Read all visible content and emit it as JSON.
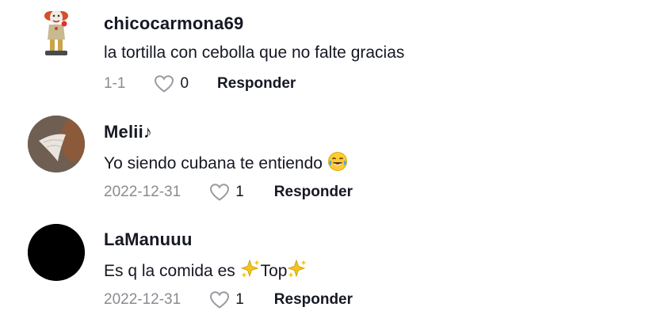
{
  "comments": [
    {
      "username": "chicocarmona69",
      "text": "la tortilla con cebolla que no falte gracias",
      "date": "1-1",
      "likes": "0",
      "reply_label": "Responder",
      "avatar_icon": "pennywise-figure-avatar",
      "emojis": []
    },
    {
      "username": "Melii♪",
      "text": "Yo siendo cubana te entiendo",
      "date": "2022-12-31",
      "likes": "1",
      "reply_label": "Responder",
      "avatar_icon": "wing-photo-avatar",
      "emojis": [
        "😂"
      ]
    },
    {
      "username": "LaManuuu",
      "text_before": "Es q la comida es",
      "text_middle": "Top",
      "date": "2022-12-31",
      "likes": "1",
      "reply_label": "Responder",
      "avatar_icon": "black-circle-avatar",
      "emojis": [
        "✨",
        "✨"
      ]
    }
  ],
  "colors": {
    "text": "#161823",
    "meta": "#8a8b91",
    "sparkle": "#f5c518"
  }
}
